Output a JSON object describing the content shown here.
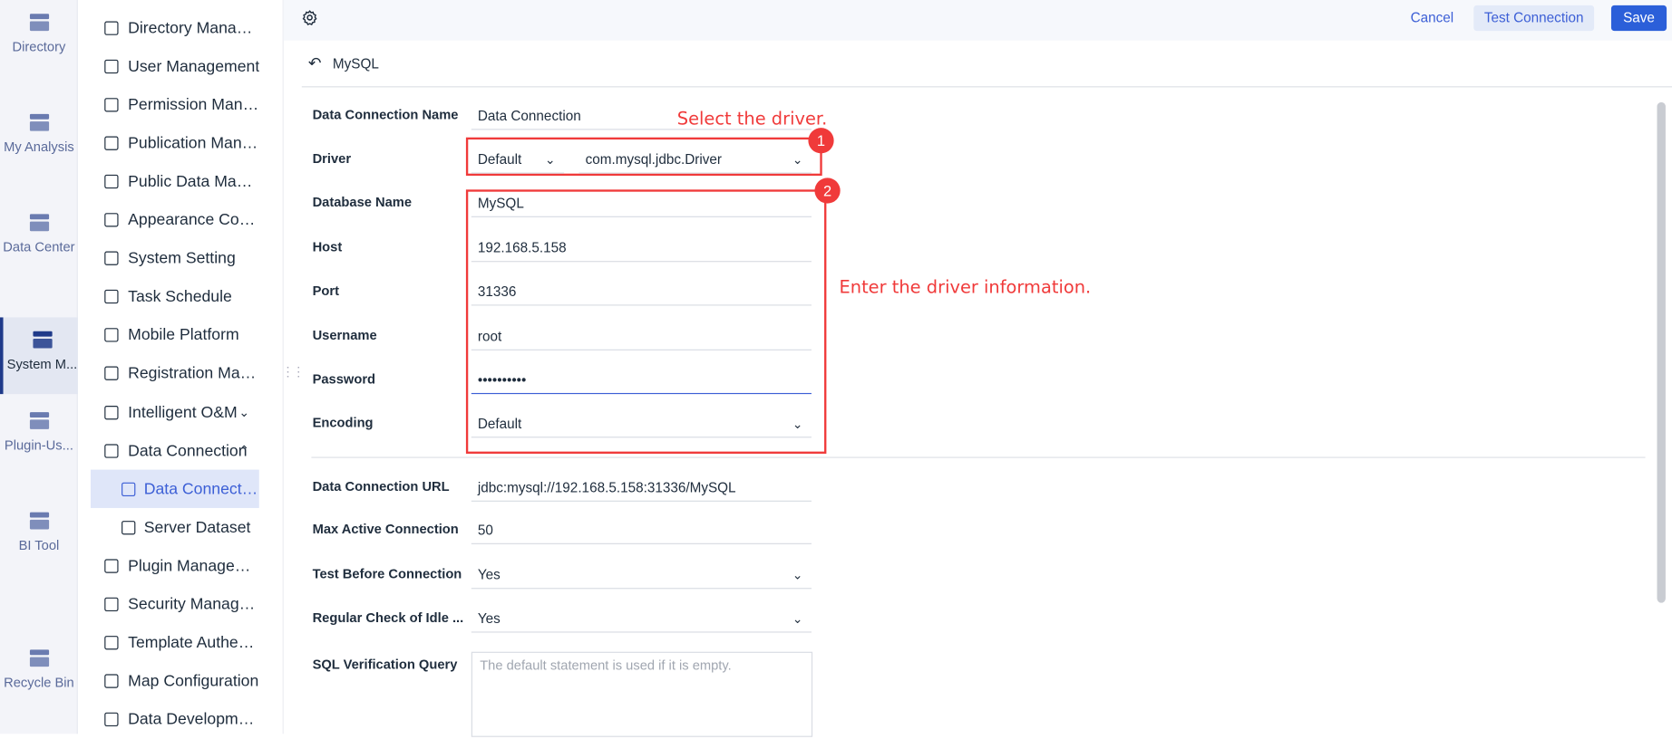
{
  "rail": [
    {
      "label": "Directory",
      "icon": "directory-icon"
    },
    {
      "label": "My Analysis",
      "icon": "analysis-icon"
    },
    {
      "label": "Data Center",
      "icon": "data-center-icon"
    },
    {
      "label": "System M...",
      "icon": "system-gear-icon",
      "active": true
    },
    {
      "label": "Plugin-Us...",
      "icon": "plugin-user-icon"
    },
    {
      "label": "BI Tool",
      "icon": "toolbox-icon"
    },
    {
      "label": "Recycle Bin",
      "icon": "recycle-icon"
    }
  ],
  "nav": [
    {
      "label": "Directory Management"
    },
    {
      "label": "User Management"
    },
    {
      "label": "Permission Management"
    },
    {
      "label": "Publication Management"
    },
    {
      "label": "Public Data Management"
    },
    {
      "label": "Appearance Configuration"
    },
    {
      "label": "System Setting"
    },
    {
      "label": "Task Schedule"
    },
    {
      "label": "Mobile Platform"
    },
    {
      "label": "Registration Management"
    },
    {
      "label": "Intelligent O&M",
      "chevron": "⌄"
    },
    {
      "label": "Data Connection",
      "chevron": "⌃"
    },
    {
      "label": "Data Connection",
      "sub": true,
      "active": true
    },
    {
      "label": "Server Dataset",
      "sub": true
    },
    {
      "label": "Plugin Management"
    },
    {
      "label": "Security Management"
    },
    {
      "label": "Template Authentication"
    },
    {
      "label": "Map Configuration"
    },
    {
      "label": "Data Development"
    }
  ],
  "toolbar": {
    "cancel": "Cancel",
    "test": "Test Connection",
    "save": "Save"
  },
  "header": {
    "title": "MySQL"
  },
  "form": {
    "name_label": "Data Connection Name",
    "name_value": "Data Connection",
    "driver_label": "Driver",
    "driver_type": "Default",
    "driver_class": "com.mysql.jdbc.Driver",
    "db_label": "Database Name",
    "db_value": "MySQL",
    "host_label": "Host",
    "host_value": "192.168.5.158",
    "port_label": "Port",
    "port_value": "31336",
    "user_label": "Username",
    "user_value": "root",
    "pass_label": "Password",
    "pass_value": "••••••••••",
    "enc_label": "Encoding",
    "enc_value": "Default",
    "url_label": "Data Connection URL",
    "url_value": "jdbc:mysql://192.168.5.158:31336/MySQL",
    "max_label": "Max Active Connection",
    "max_value": "50",
    "test_label": "Test Before Connection",
    "test_value": "Yes",
    "idle_label": "Regular Check of Idle ...",
    "idle_value": "Yes",
    "sql_label": "SQL Verification Query",
    "sql_placeholder": "The default statement is used if it is empty."
  },
  "annotations": {
    "note1": "Select the driver.",
    "note2": "Enter the driver information.",
    "badge1": "1",
    "badge2": "2"
  },
  "colors": {
    "accent": "#2b5fd9",
    "annotation": "#f03a3a"
  }
}
